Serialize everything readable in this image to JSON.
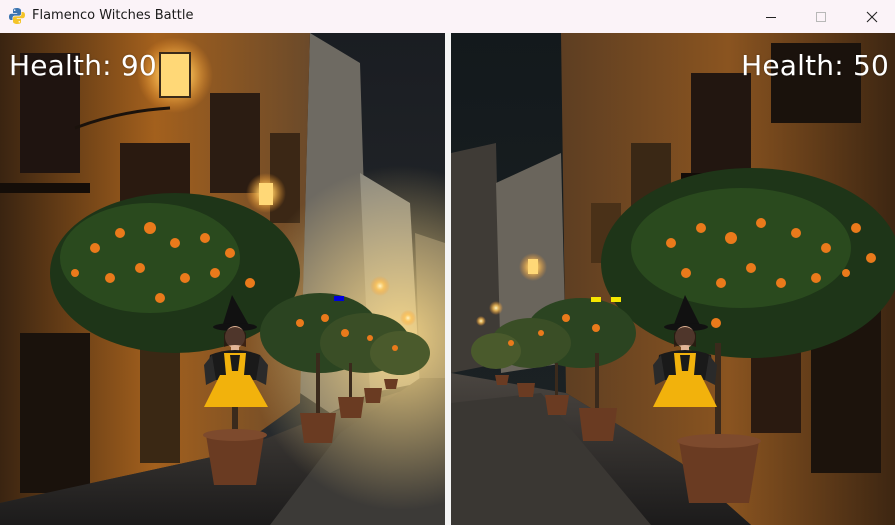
{
  "window": {
    "title": "Flamenco Witches Battle",
    "icon": "python-icon",
    "controls": [
      "minimize-icon",
      "maximize-icon",
      "close-icon"
    ]
  },
  "players": [
    {
      "side": "left",
      "health_label": "Health: 90",
      "health": 90,
      "marker_color": "#0000dd"
    },
    {
      "side": "right",
      "health_label": "Health: 50",
      "health": 50,
      "marker_color": "#f5e600"
    }
  ],
  "colors": {
    "title_bar": "#fbf3f8",
    "divider": "#f4f4f4",
    "dress": "#f2b20c",
    "lamp_glow": "#ffcf6a"
  }
}
